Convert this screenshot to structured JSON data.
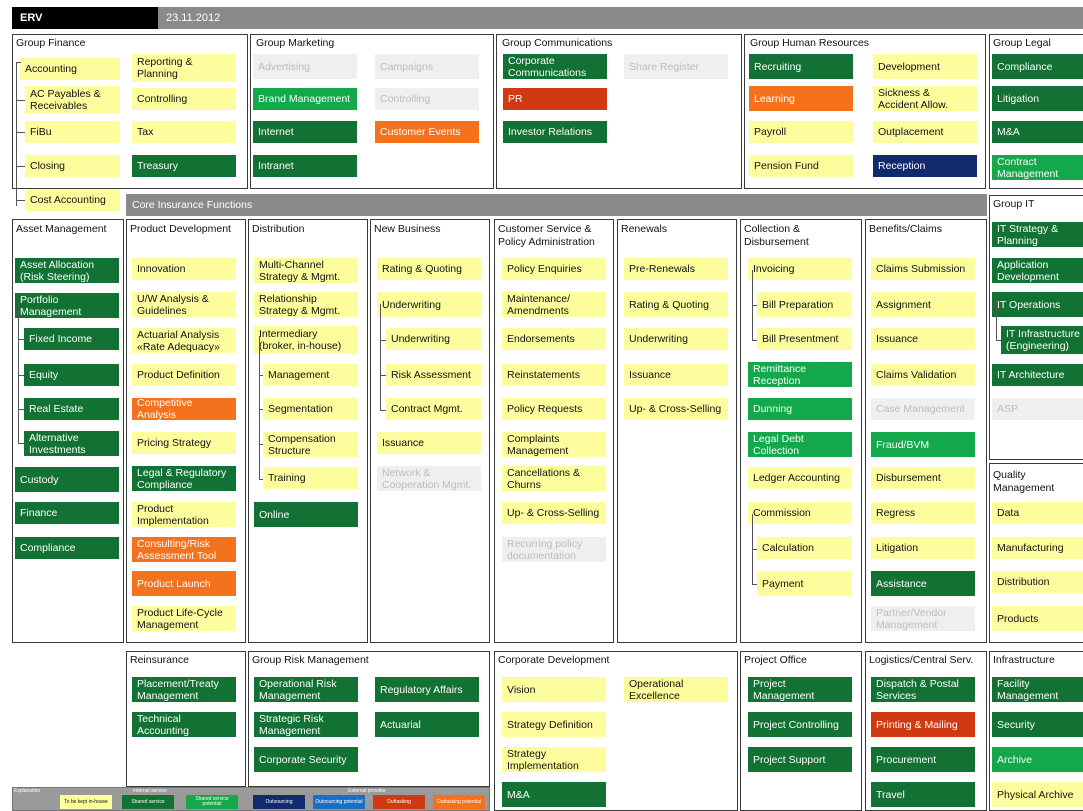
{
  "header": {
    "company": "ERV",
    "date": "23.11.2012"
  },
  "colors": {
    "yellow": "#fdfd9e",
    "green": "#127233",
    "light_green": "#13a84a",
    "orange": "#f4721e",
    "red": "#d03a12",
    "navy": "#102a6b",
    "grey": "#efefef",
    "blue": "#1a6fc2"
  },
  "core_strip": "Core Insurance Functions",
  "panels": [
    {
      "title": "Group Finance",
      "items": [
        {
          "text": "Accounting",
          "c": "y"
        },
        {
          "text": "AC Payables & Receivables",
          "c": "y"
        },
        {
          "text": "FiBu",
          "c": "y"
        },
        {
          "text": "Closing",
          "c": "y"
        },
        {
          "text": "Cost Accounting",
          "c": "y"
        },
        {
          "text": "Reporting & Planning",
          "c": "y"
        },
        {
          "text": "Controlling",
          "c": "y"
        },
        {
          "text": "Tax",
          "c": "y"
        },
        {
          "text": "Treasury",
          "c": "g"
        }
      ]
    },
    {
      "title": "Group Marketing",
      "items": [
        {
          "text": "Advertising",
          "c": "gr"
        },
        {
          "text": "Brand Management",
          "c": "lg"
        },
        {
          "text": "Internet",
          "c": "g"
        },
        {
          "text": "Intranet",
          "c": "g"
        },
        {
          "text": "Campaigns",
          "c": "gr"
        },
        {
          "text": "Controlling",
          "c": "gr"
        },
        {
          "text": "Customer Events",
          "c": "o"
        }
      ]
    },
    {
      "title": "Group Communications",
      "items": [
        {
          "text": "Corporate Communications",
          "c": "g"
        },
        {
          "text": "PR",
          "c": "r"
        },
        {
          "text": "Investor Relations",
          "c": "g"
        },
        {
          "text": "Share Register",
          "c": "gr"
        }
      ]
    },
    {
      "title": "Group Human Resources",
      "items": [
        {
          "text": "Recruiting",
          "c": "g"
        },
        {
          "text": "Learning",
          "c": "o"
        },
        {
          "text": "Payroll",
          "c": "y"
        },
        {
          "text": "Pension Fund",
          "c": "y"
        },
        {
          "text": "Development",
          "c": "y"
        },
        {
          "text": "Sickness & Accident Allow.",
          "c": "y"
        },
        {
          "text": "Outplacement",
          "c": "y"
        },
        {
          "text": "Reception",
          "c": "n"
        }
      ]
    },
    {
      "title": "Group Legal",
      "items": [
        {
          "text": "Compliance",
          "c": "g"
        },
        {
          "text": "Litigation",
          "c": "g"
        },
        {
          "text": "M&A",
          "c": "g"
        },
        {
          "text": "Contract Management",
          "c": "lg"
        }
      ]
    },
    {
      "title": "Asset Management",
      "items": [
        {
          "text": "Asset Allocation (Risk Steering)",
          "c": "g"
        },
        {
          "text": "Portfolio Management",
          "c": "g"
        },
        {
          "text": "Fixed Income",
          "c": "g"
        },
        {
          "text": "Equity",
          "c": "g"
        },
        {
          "text": "Real Estate",
          "c": "g"
        },
        {
          "text": "Alternative Investments",
          "c": "g"
        },
        {
          "text": "Custody",
          "c": "g"
        },
        {
          "text": "Finance",
          "c": "g"
        },
        {
          "text": "Compliance",
          "c": "g"
        }
      ]
    },
    {
      "title": "Product Development",
      "items": [
        {
          "text": "Innovation",
          "c": "y"
        },
        {
          "text": "U/W Analysis & Guidelines",
          "c": "y"
        },
        {
          "text": "Actuarial Analysis «Rate Adequacy»",
          "c": "y"
        },
        {
          "text": "Product Definition",
          "c": "y"
        },
        {
          "text": "Competitive Analysis",
          "c": "o"
        },
        {
          "text": "Pricing Strategy",
          "c": "y"
        },
        {
          "text": "Legal & Regulatory Compliance",
          "c": "g"
        },
        {
          "text": "Product Implementation",
          "c": "y"
        },
        {
          "text": "Consulting/Risk Assessment Tool",
          "c": "o"
        },
        {
          "text": "Product Launch",
          "c": "o"
        },
        {
          "text": "Product Life-Cycle Management",
          "c": "y"
        }
      ]
    },
    {
      "title": "Distribution",
      "items": [
        {
          "text": "Multi-Channel Strategy & Mgmt.",
          "c": "y"
        },
        {
          "text": "Relationship Strategy & Mgmt.",
          "c": "y"
        },
        {
          "text": "Intermediary (broker, in-house)",
          "c": "y"
        },
        {
          "text": "Management",
          "c": "y"
        },
        {
          "text": "Segmentation",
          "c": "y"
        },
        {
          "text": "Compensation Structure",
          "c": "y"
        },
        {
          "text": "Training",
          "c": "y"
        },
        {
          "text": "Online",
          "c": "g"
        }
      ]
    },
    {
      "title": "New Business",
      "items": [
        {
          "text": "Rating & Quoting",
          "c": "y"
        },
        {
          "text": "Underwriting",
          "c": "y"
        },
        {
          "text": "Underwriting",
          "c": "y"
        },
        {
          "text": "Risk Assessment",
          "c": "y"
        },
        {
          "text": "Contract Mgmt.",
          "c": "y"
        },
        {
          "text": "Issuance",
          "c": "y"
        },
        {
          "text": "Network & Cooperation Mgmt.",
          "c": "gr"
        }
      ]
    },
    {
      "title": "Customer Service & Policy Administration",
      "items": [
        {
          "text": "Policy Enquiries",
          "c": "y"
        },
        {
          "text": "Maintenance/ Amendments",
          "c": "y"
        },
        {
          "text": "Endorsements",
          "c": "y"
        },
        {
          "text": "Reinstatements",
          "c": "y"
        },
        {
          "text": "Policy Requests",
          "c": "y"
        },
        {
          "text": "Complaints Management",
          "c": "y"
        },
        {
          "text": "Cancellations & Churns",
          "c": "y"
        },
        {
          "text": "Up- & Cross-Selling",
          "c": "y"
        },
        {
          "text": "Recurring policy documentation",
          "c": "gr"
        }
      ]
    },
    {
      "title": "Renewals",
      "items": [
        {
          "text": "Pre-Renewals",
          "c": "y"
        },
        {
          "text": "Rating & Quoting",
          "c": "y"
        },
        {
          "text": "Underwriting",
          "c": "y"
        },
        {
          "text": "Issuance",
          "c": "y"
        },
        {
          "text": "Up- & Cross-Selling",
          "c": "y"
        }
      ]
    },
    {
      "title": "Collection & Disbursement",
      "items": [
        {
          "text": "Invoicing",
          "c": "y"
        },
        {
          "text": "Bill Preparation",
          "c": "y"
        },
        {
          "text": "Bill Presentment",
          "c": "y"
        },
        {
          "text": "Remittance Reception",
          "c": "lg"
        },
        {
          "text": "Dunning",
          "c": "lg"
        },
        {
          "text": "Legal Debt Collection",
          "c": "lg"
        },
        {
          "text": "Ledger Accounting",
          "c": "y"
        },
        {
          "text": "Commission",
          "c": "y"
        },
        {
          "text": "Calculation",
          "c": "y"
        },
        {
          "text": "Payment",
          "c": "y"
        }
      ]
    },
    {
      "title": "Benefits/Claims",
      "items": [
        {
          "text": "Claims Submission",
          "c": "y"
        },
        {
          "text": "Assignment",
          "c": "y"
        },
        {
          "text": "Issuance",
          "c": "y"
        },
        {
          "text": "Claims Validation",
          "c": "y"
        },
        {
          "text": "Case Management",
          "c": "gr"
        },
        {
          "text": "Fraud/BVM",
          "c": "lg"
        },
        {
          "text": "Disbursement",
          "c": "y"
        },
        {
          "text": "Regress",
          "c": "y"
        },
        {
          "text": "Litigation",
          "c": "y"
        },
        {
          "text": "Assistance",
          "c": "g"
        },
        {
          "text": "Partner/Vendor Management",
          "c": "gr"
        }
      ]
    },
    {
      "title": "Group IT",
      "items": [
        {
          "text": "IT Strategy & Planning",
          "c": "g"
        },
        {
          "text": "Application Development",
          "c": "g"
        },
        {
          "text": "IT Operations",
          "c": "g"
        },
        {
          "text": "IT Infrastructure (Engineering)",
          "c": "g"
        },
        {
          "text": "IT Architecture",
          "c": "g"
        },
        {
          "text": "ASP",
          "c": "gr"
        }
      ]
    },
    {
      "title": "Quality Management",
      "items": [
        {
          "text": "Data",
          "c": "y"
        },
        {
          "text": "Manufacturing",
          "c": "y"
        },
        {
          "text": "Distribution",
          "c": "y"
        },
        {
          "text": "Products",
          "c": "y"
        }
      ]
    },
    {
      "title": "Reinsurance",
      "items": [
        {
          "text": "Placement/Treaty Management",
          "c": "g"
        },
        {
          "text": "Technical Accounting",
          "c": "g"
        }
      ]
    },
    {
      "title": "Group Risk Management",
      "items": [
        {
          "text": "Operational Risk Management",
          "c": "g"
        },
        {
          "text": "Strategic Risk Management",
          "c": "g"
        },
        {
          "text": "Corporate Security",
          "c": "g"
        },
        {
          "text": "Regulatory Affairs",
          "c": "g"
        },
        {
          "text": "Actuarial",
          "c": "g"
        }
      ]
    },
    {
      "title": "Corporate Development",
      "items": [
        {
          "text": "Vision",
          "c": "y"
        },
        {
          "text": "Strategy Definition",
          "c": "y"
        },
        {
          "text": "Strategy Implementation",
          "c": "y"
        },
        {
          "text": "M&A",
          "c": "g"
        },
        {
          "text": "Operational Excellence",
          "c": "y"
        }
      ]
    },
    {
      "title": "Project Office",
      "items": [
        {
          "text": "Project Management",
          "c": "g"
        },
        {
          "text": "Project Controlling",
          "c": "g"
        },
        {
          "text": "Project Support",
          "c": "g"
        }
      ]
    },
    {
      "title": "Logistics/Central Serv.",
      "items": [
        {
          "text": "Dispatch & Postal Services",
          "c": "g"
        },
        {
          "text": "Printing & Mailing",
          "c": "r"
        },
        {
          "text": "Procurement",
          "c": "g"
        },
        {
          "text": "Travel",
          "c": "g"
        }
      ]
    },
    {
      "title": "Infrastructure",
      "items": [
        {
          "text": "Facility Management",
          "c": "g"
        },
        {
          "text": "Security",
          "c": "g"
        },
        {
          "text": "Archive",
          "c": "lg"
        },
        {
          "text": "Physical Archive",
          "c": "y"
        }
      ]
    }
  ],
  "legend": {
    "title": "Explanation",
    "internal": "internal service",
    "external": "External provider",
    "items": [
      {
        "text": "To be kept in-house",
        "c": "y"
      },
      {
        "text": "Shared service",
        "c": "g"
      },
      {
        "text": "Shared service potential",
        "c": "lg"
      },
      {
        "text": "Outsourcing",
        "c": "n"
      },
      {
        "text": "Outsourcing potential",
        "c": "bl"
      },
      {
        "text": "Outtasking",
        "c": "r"
      },
      {
        "text": "Outtasking potential",
        "c": "o"
      }
    ]
  }
}
